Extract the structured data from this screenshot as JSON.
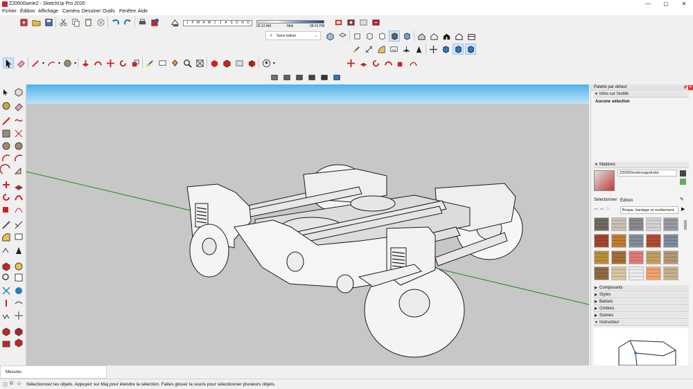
{
  "window": {
    "title": "Z20500serie2 - SketchUp Pro 2020",
    "controls": [
      "—",
      "▢",
      "✕"
    ]
  },
  "menubar": {
    "items": [
      "Fichier",
      "Édition",
      "Affichage",
      "Caméra",
      "Dessiner",
      "Outils",
      "Fenêtre",
      "Aide"
    ]
  },
  "shadows": {
    "months": [
      "J",
      "F",
      "M",
      "A",
      "M",
      "J",
      "J",
      "A",
      "S",
      "O",
      "N",
      "D"
    ],
    "time_start": "05:12 AM",
    "time_mid": "Midi",
    "time_end": "08:41 PM"
  },
  "tags": {
    "check": "✓",
    "selected": "Sans balise"
  },
  "tray": {
    "title": "Palette par défaut",
    "entity_info": {
      "header": "Infos sur l'entité",
      "status": "Aucune sélection"
    },
    "materials": {
      "header": "Matières",
      "current_name": "Z20500cotérougedroite",
      "tab_select": "Sélectionner",
      "tab_edit": "Édition",
      "library": "Brique, bardage et revêtement"
    },
    "swatch_colors": [
      "#6f6a63",
      "#c9c0b0",
      "#8a8a8a",
      "#d2d2d2",
      "#9a9aa6",
      "#a0452f",
      "#c07a32",
      "#858d97",
      "#b34a36",
      "#7d8aa0",
      "#b9903a",
      "#a56f3a",
      "#e07a7a",
      "#c0a060",
      "#b49777",
      "#8e6b45",
      "#d8c6a0",
      "#ececec",
      "#f2a26a",
      "#c7b08e"
    ],
    "sections": [
      "Composants",
      "Styles",
      "Balises",
      "Ombres",
      "Scènes",
      "Instructeur"
    ]
  },
  "measurements": {
    "label": "Mesures"
  },
  "status": {
    "message": "Sélectionnez les objets. Appuyez sur Maj pour étendre la sélection. Faites glisser la souris pour sélectionner plusieurs objets."
  },
  "colors": {
    "sky": "#7fc9f2",
    "ground": "#c7c7c7",
    "green_axis": "#1f8a1f",
    "model_face": "#f2f2f2",
    "model_edge": "#1a1a1a"
  }
}
